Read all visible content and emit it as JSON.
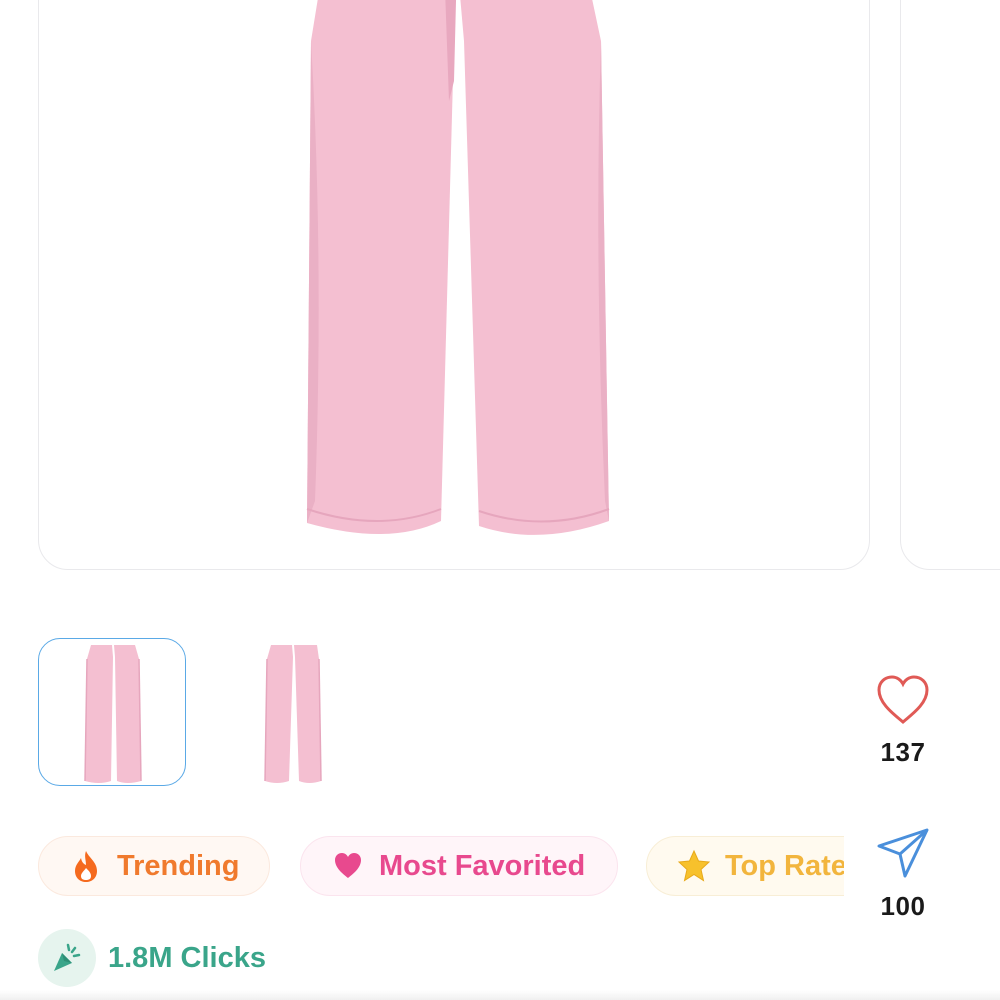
{
  "product": {
    "main_image": "pink-pants-front",
    "thumbnails": [
      {
        "image": "pink-pants-front",
        "selected": true
      },
      {
        "image": "pink-pants-back",
        "selected": false
      }
    ]
  },
  "actions": {
    "like": {
      "icon": "heart-icon",
      "count": "137"
    },
    "share": {
      "icon": "send-icon",
      "count": "100"
    }
  },
  "tags": [
    {
      "icon": "fire-icon",
      "label": "Trending",
      "color": "#f07a2d"
    },
    {
      "icon": "heart-icon",
      "label": "Most Favorited",
      "color": "#e8498e"
    },
    {
      "icon": "star-icon",
      "label": "Top Rate",
      "color": "#f2b53d"
    }
  ],
  "stats": {
    "icon": "click-icon",
    "clicks_label": "1.8M Clicks",
    "color": "#3aa58a"
  },
  "colors": {
    "pants": "#f4bfd1",
    "pants_shade": "#e8a8bf",
    "selected_border": "#5aa9e6",
    "like_heart": "#e05a56",
    "share_icon": "#4a8fdb"
  }
}
